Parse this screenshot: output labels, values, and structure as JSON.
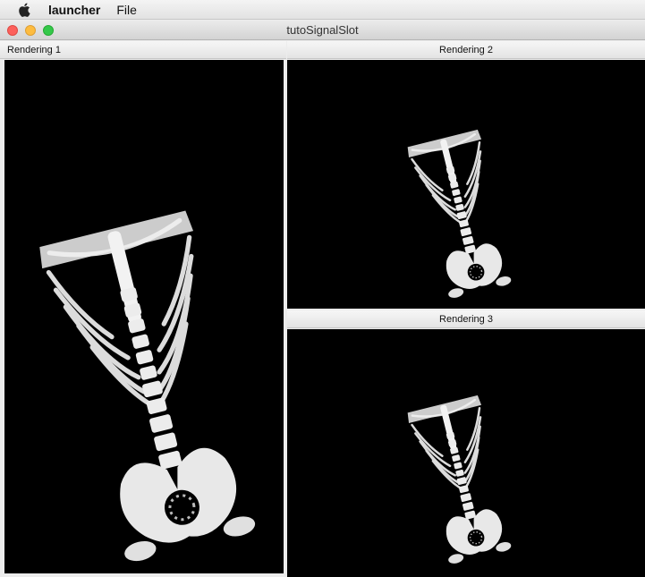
{
  "menubar": {
    "apple_icon": "apple-logo-icon",
    "app_name": "launcher",
    "file_menu": "File"
  },
  "window": {
    "title": "tutoSignalSlot",
    "close_color": "#fc605b",
    "minimize_color": "#fdbc40",
    "zoom_color": "#34c84a"
  },
  "views": {
    "rendering1": {
      "title": "Rendering 1"
    },
    "rendering2": {
      "title": "Rendering 2"
    },
    "rendering3": {
      "title": "Rendering 3"
    }
  },
  "scene": {
    "background": "#000000",
    "model_color": "#e6e6e6"
  }
}
